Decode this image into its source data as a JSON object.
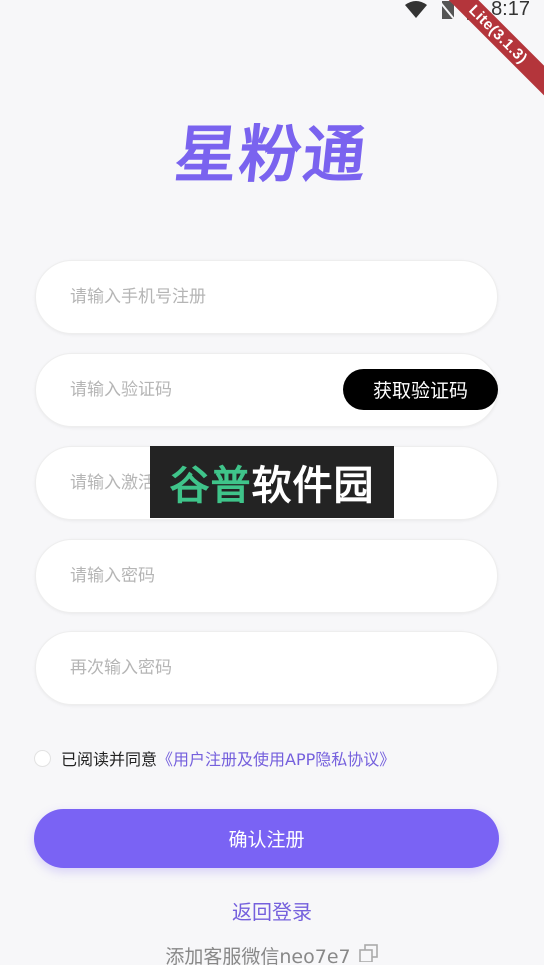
{
  "status_bar": {
    "time": "8:17",
    "debug_badge": "Lite(3.1.3)"
  },
  "app": {
    "logo_text": "星粉通"
  },
  "form": {
    "phone_placeholder": "请输入手机号注册",
    "code_placeholder": "请输入验证码",
    "get_code_label": "获取验证码",
    "invite_placeholder": "请输入激活码",
    "password_placeholder": "请输入密码",
    "confirm_password_placeholder": "再次输入密码"
  },
  "watermark": {
    "part1": "谷普",
    "part2": "软件园"
  },
  "agreement": {
    "prefix": "已阅读并同意",
    "link": "《用户注册及使用APP隐私协议》"
  },
  "actions": {
    "submit_label": "确认注册",
    "back_to_login": "返回登录",
    "service_text": "添加客服微信neo7e7"
  },
  "icons": [
    "wifi-icon",
    "no-sim-icon",
    "battery-charging-icon",
    "copy-icon"
  ],
  "colors": {
    "primary": "#7a63f4",
    "link": "#7560dd",
    "ribbon": "#b4353b"
  }
}
